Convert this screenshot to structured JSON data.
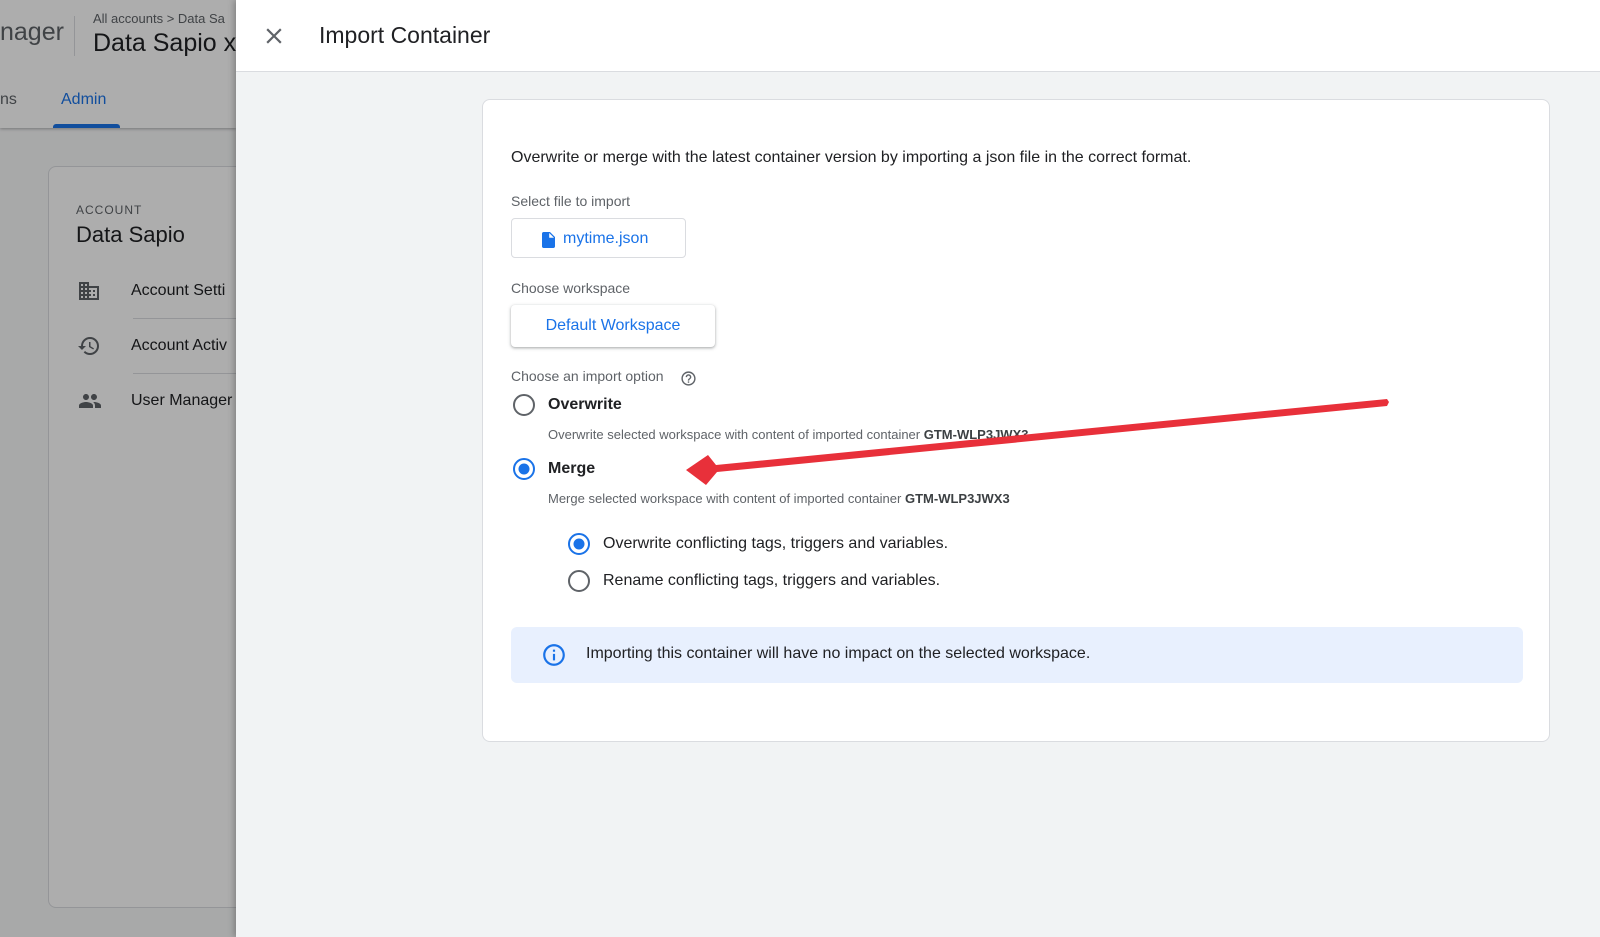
{
  "background": {
    "product_name": "nager",
    "breadcrumb": "All accounts  >  Data Sa",
    "container_name": "Data Sapio x",
    "tabs": {
      "previous": "ns",
      "admin": "Admin"
    },
    "account_label": "ACCOUNT",
    "account_name": "Data Sapio",
    "menu_items": [
      {
        "label": "Account Setti",
        "icon": "building-icon"
      },
      {
        "label": "Account Activ",
        "icon": "history-icon"
      },
      {
        "label": "User Manager",
        "icon": "people-icon"
      }
    ]
  },
  "panel": {
    "title": "Import Container",
    "intro": "Overwrite or merge with the latest container version by importing a json file in the correct format.",
    "file_label": "Select file to import",
    "file_name": "mytime.json",
    "workspace_label": "Choose workspace",
    "workspace_name": "Default Workspace",
    "import_option_label": "Choose an import option",
    "options": {
      "overwrite": {
        "title": "Overwrite",
        "desc": "Overwrite selected workspace with content of imported container",
        "container_id": "GTM-WLP3JWX3",
        "selected": false
      },
      "merge": {
        "title": "Merge",
        "desc": "Merge selected workspace with content of imported container",
        "container_id": "GTM-WLP3JWX3",
        "selected": true
      }
    },
    "merge_options": [
      {
        "label": "Overwrite conflicting tags, triggers and variables.",
        "selected": true
      },
      {
        "label": "Rename conflicting tags, triggers and variables.",
        "selected": false
      }
    ],
    "info_message": "Importing this container will have no impact on the selected workspace."
  },
  "colors": {
    "accent": "#1a73e8",
    "annotation_arrow": "#e8303a",
    "info_background": "#e8f0fe"
  }
}
